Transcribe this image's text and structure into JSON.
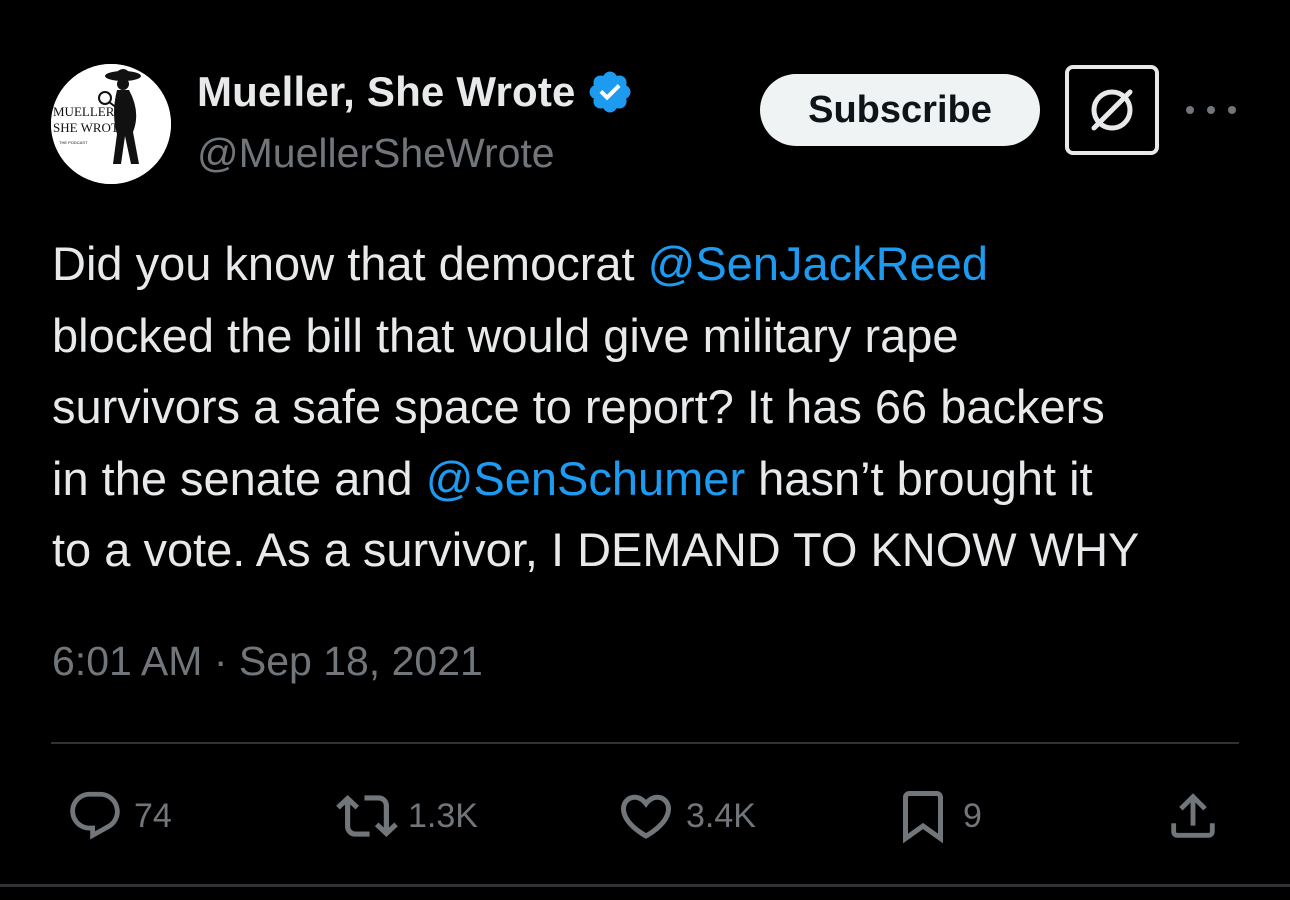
{
  "author": {
    "display_name": "Mueller, She Wrote",
    "handle": "@MuellerSheWrote",
    "verified": true,
    "avatar_text_line1": "MUELLER,",
    "avatar_text_line2": "SHE WROTE",
    "avatar_text_line3": "THE PODCAST"
  },
  "header": {
    "subscribe_label": "Subscribe",
    "grok_icon": "grok-icon",
    "more_icon": "more-icon"
  },
  "tweet": {
    "lines": [
      {
        "before": "Did you know that democrat ",
        "mention": "@SenJackReed",
        "after": ""
      },
      {
        "before": "blocked the bill that would give military rape",
        "mention": "",
        "after": ""
      },
      {
        "before": "survivors a safe space to report? It has 66 backers",
        "mention": "",
        "after": ""
      },
      {
        "before": "in the senate and ",
        "mention": "@SenSchumer",
        "after": " hasn’t brought it"
      },
      {
        "before": "to a vote. As a survivor, I DEMAND TO KNOW WHY",
        "mention": "",
        "after": ""
      }
    ],
    "timestamp": "6:01 AM · Sep 18, 2021"
  },
  "actions": {
    "replies": "74",
    "reposts": "1.3K",
    "likes": "3.4K",
    "bookmarks": "9"
  },
  "colors": {
    "background": "#000000",
    "text": "#e7e9ea",
    "secondary": "#71767b",
    "accent": "#1d9bf0",
    "divider": "#2f3336"
  }
}
